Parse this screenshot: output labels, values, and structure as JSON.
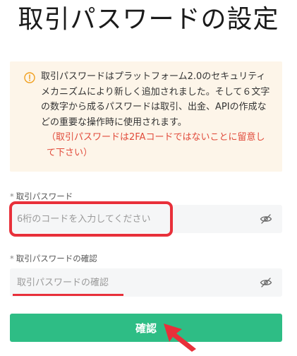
{
  "page": {
    "title": "取引パスワードの設定"
  },
  "notice": {
    "icon": "info-circle-icon",
    "text": "取引パスワードはプラットフォーム2.0のセキュリティメカニズムにより新しく追加されました。そして６文字の数字から成るパスワードは取引、出金、APIの作成などの重要な操作時に使用されます。",
    "warning": "（取引パスワードは2FAコードではないことに留意して下さい）",
    "colors": {
      "background": "#fdf5e9",
      "icon": "#f0a020",
      "warning": "#e14b3b"
    }
  },
  "form": {
    "password": {
      "required_mark": "*",
      "label": "取引パスワード",
      "placeholder": "6桁のコードを入力してください",
      "value": "",
      "toggle_icon": "eye-off-icon"
    },
    "confirm_password": {
      "required_mark": "*",
      "label": "取引パスワードの確認",
      "placeholder": "取引パスワードの確認",
      "value": "",
      "toggle_icon": "eye-off-icon"
    },
    "submit_label": "確認"
  },
  "annotations": {
    "color": "#e8303a",
    "items": [
      "highlight-box",
      "underline",
      "arrow"
    ]
  },
  "colors": {
    "primary": "#2ebd85",
    "input_background": "#f5f6f7"
  }
}
